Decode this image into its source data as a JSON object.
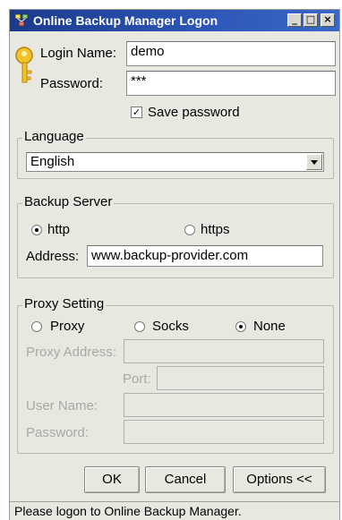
{
  "window": {
    "title": "Online Backup Manager Logon",
    "minimize_label": "_",
    "maximize_label": "□",
    "close_label": "×"
  },
  "login": {
    "login_name_label": "Login Name:",
    "login_name_value": "demo",
    "password_label": "Password:",
    "password_value": "***",
    "save_password_label": "Save password",
    "save_password_checked": true,
    "save_password_mark": "✓"
  },
  "language": {
    "group_label": "Language",
    "selected": "English"
  },
  "backup_server": {
    "group_label": "Backup Server",
    "http_label": "http",
    "https_label": "https",
    "selected_protocol": "http",
    "address_label": "Address:",
    "address_value": "www.backup-provider.com"
  },
  "proxy": {
    "group_label": "Proxy Setting",
    "proxy_label": "Proxy",
    "socks_label": "Socks",
    "none_label": "None",
    "selected": "None",
    "proxy_address_label": "Proxy Address:",
    "port_label": "Port:",
    "user_name_label": "User Name:",
    "password_label": "Password:"
  },
  "buttons": {
    "ok_label": "OK",
    "cancel_label": "Cancel",
    "options_label": "Options <<"
  },
  "status": {
    "text": "Please logon to Online Backup Manager."
  },
  "colors": {
    "titlebar": "#2d56b8",
    "dialog_bg": "#e8e8e0",
    "disabled_text": "#a8a8a8"
  }
}
